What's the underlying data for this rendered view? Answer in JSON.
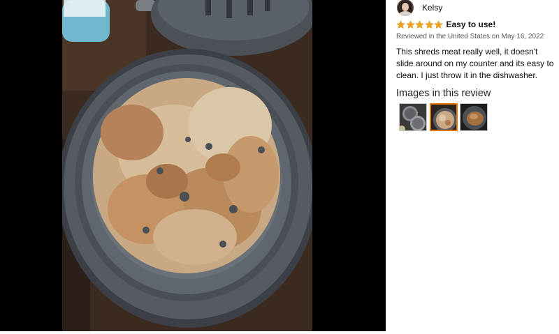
{
  "review": {
    "reviewer_name": "Kelsy",
    "rating": 5,
    "title": "Easy to use!",
    "meta": "Reviewed in the United States on May 16, 2022",
    "body": "This shreds meat really well, it doesn't slide around on my counter and its easy to clean. I just throw it in the dishwasher.",
    "images_heading": "Images in this review",
    "selected_thumbnail": 2
  },
  "colors": {
    "star": "#f0a21d",
    "selected_border": "#e77600",
    "body_text": "#0f1111",
    "meta_text": "#565959"
  },
  "icons": [
    "avatar",
    "star-icon",
    "thumbnail-image"
  ]
}
